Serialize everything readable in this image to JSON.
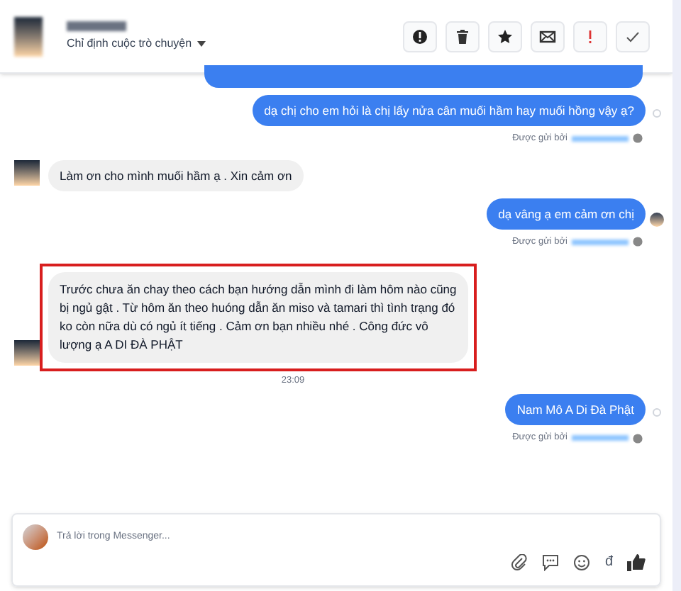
{
  "header": {
    "subtitle": "Chỉ định cuộc trò chuyện",
    "actions": [
      {
        "kind": "report"
      },
      {
        "kind": "delete"
      },
      {
        "kind": "star"
      },
      {
        "kind": "mail"
      },
      {
        "kind": "important"
      },
      {
        "kind": "done"
      }
    ]
  },
  "messages": [
    {
      "kind": "partial"
    },
    {
      "kind": "outgoing",
      "text": "dạ chị cho em hỏi là chị lấy nửa cân muối hầm hay muối hồng vậy ạ?",
      "sent_by": "Được gửi bởi",
      "seen": false
    },
    {
      "kind": "incoming",
      "text": "Làm ơn cho mình muối hầm ạ . Xin cảm ơn",
      "highlighted": false
    },
    {
      "kind": "outgoing",
      "text": "dạ vâng ạ em cảm ơn chị",
      "sent_by": "Được gửi bởi",
      "seen": true
    },
    {
      "kind": "incoming",
      "text": "Trước chưa ăn chay theo cách bạn hướng dẫn mình đi làm hôm nào cũng bị ngủ gật . Từ hôm ăn theo huóng dẫn ăn miso và tamari thì tình trạng đó ko còn nữa dù có ngủ ít tiếng . Cảm ơn bạn nhiều nhé . Công đức vô lượng ạ A DI ĐÀ PHẬT",
      "highlighted": true
    },
    {
      "kind": "time",
      "text": "23:09"
    },
    {
      "kind": "outgoing",
      "text": "Nam Mô A Di Đà Phật",
      "sent_by": "Được gửi bởi",
      "seen": false
    }
  ],
  "composer": {
    "placeholder": "Trả lời trong Messenger...",
    "currency": "đ"
  }
}
